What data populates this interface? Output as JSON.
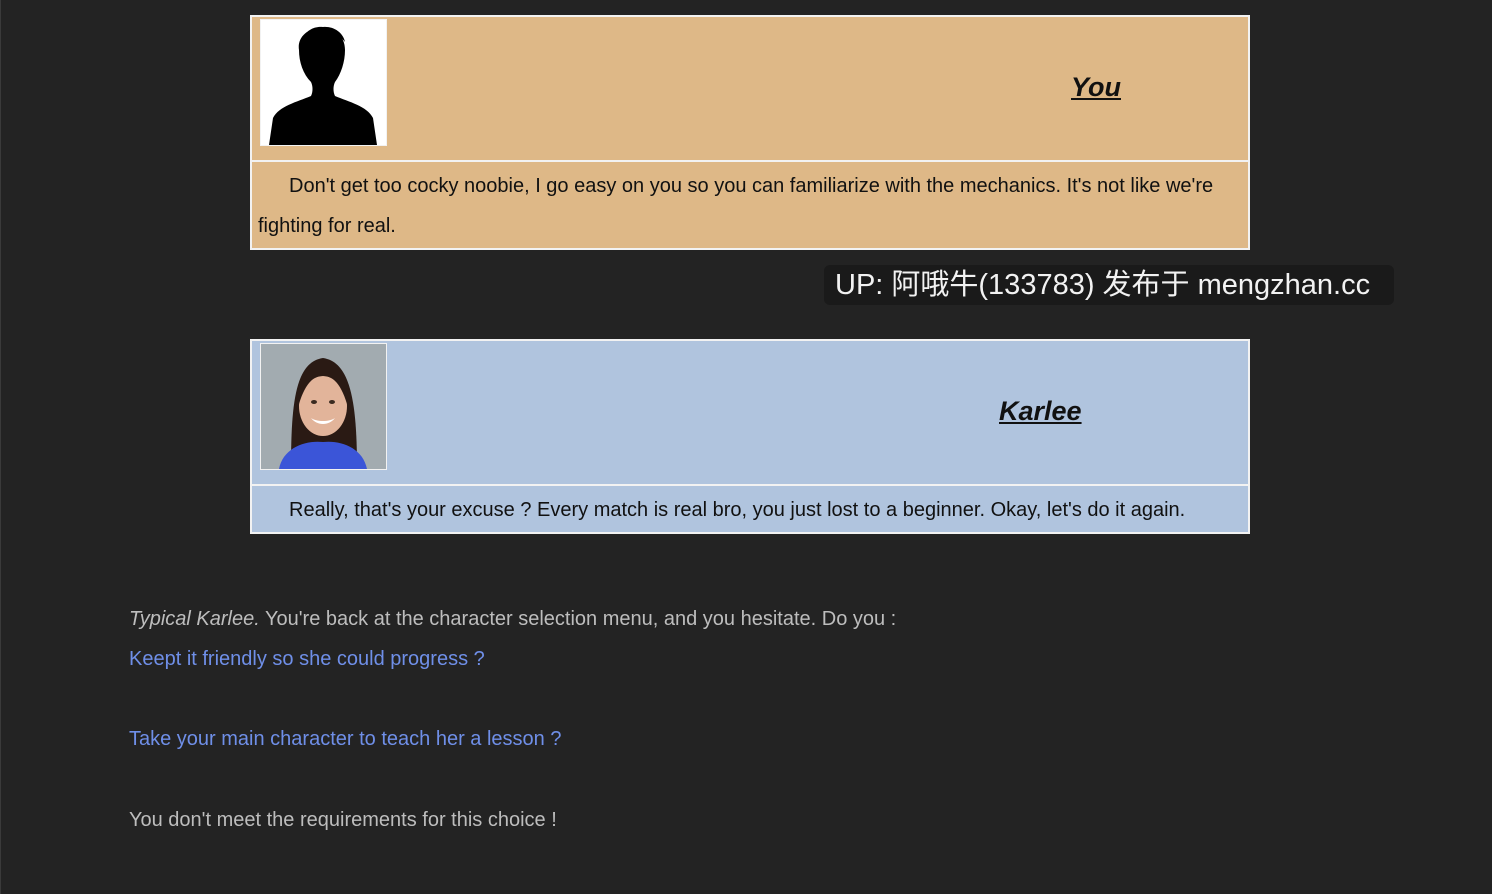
{
  "dialogs": [
    {
      "speaker": "You",
      "text": "Don't get too cocky noobie, I go easy on you so you can familiarize with the mechanics. It's not like we're fighting for real.",
      "avatar": "silhouette-icon"
    },
    {
      "speaker": "Karlee",
      "text": "Really, that's your excuse ? Every match is real bro, you just lost to a beginner. Okay, let's do it again.",
      "avatar": "karlee-portrait"
    }
  ],
  "watermark": "UP: 阿哦牛(133783) 发布于 mengzhan.cc",
  "narration": {
    "italic": "Typical Karlee.",
    "rest": " You're back at the character selection menu, and you hesitate. Do you :"
  },
  "choices": [
    "Keept it friendly so she could progress ?",
    "Take your main character to teach her a lesson ?"
  ],
  "requirement_note": "You don't meet the requirements for this choice !",
  "colors": {
    "background": "#232323",
    "you_box": "#deb887",
    "karlee_box": "#b0c4de",
    "link": "#6f8fe8",
    "narration": "#bdbdbd"
  }
}
